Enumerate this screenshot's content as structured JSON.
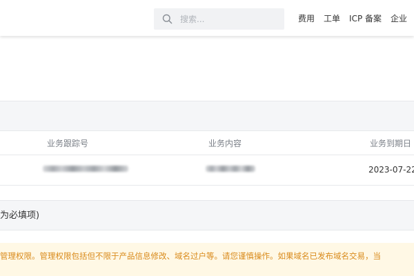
{
  "header": {
    "search": {
      "placeholder": "搜索..."
    },
    "nav": [
      {
        "label": "费用"
      },
      {
        "label": "工单"
      },
      {
        "label": "ICP 备案"
      },
      {
        "label": "企业"
      }
    ]
  },
  "table": {
    "columns": [
      {
        "label": "业务跟踪号"
      },
      {
        "label": "业务内容"
      },
      {
        "label": "业务到期日"
      }
    ],
    "rows": [
      {
        "expiry_date": "2023-07-22"
      }
    ]
  },
  "form": {
    "section_label": "为必填项)"
  },
  "notice": {
    "text": "管理权限。管理权限包括但不限于产品信息修改、域名过户等。请您谨慎操作。如果域名已发布域名交易，当"
  },
  "colors": {
    "warning_text": "#d98a1a",
    "warning_background": "#fff8e5",
    "band_background": "#f5f6f8"
  }
}
